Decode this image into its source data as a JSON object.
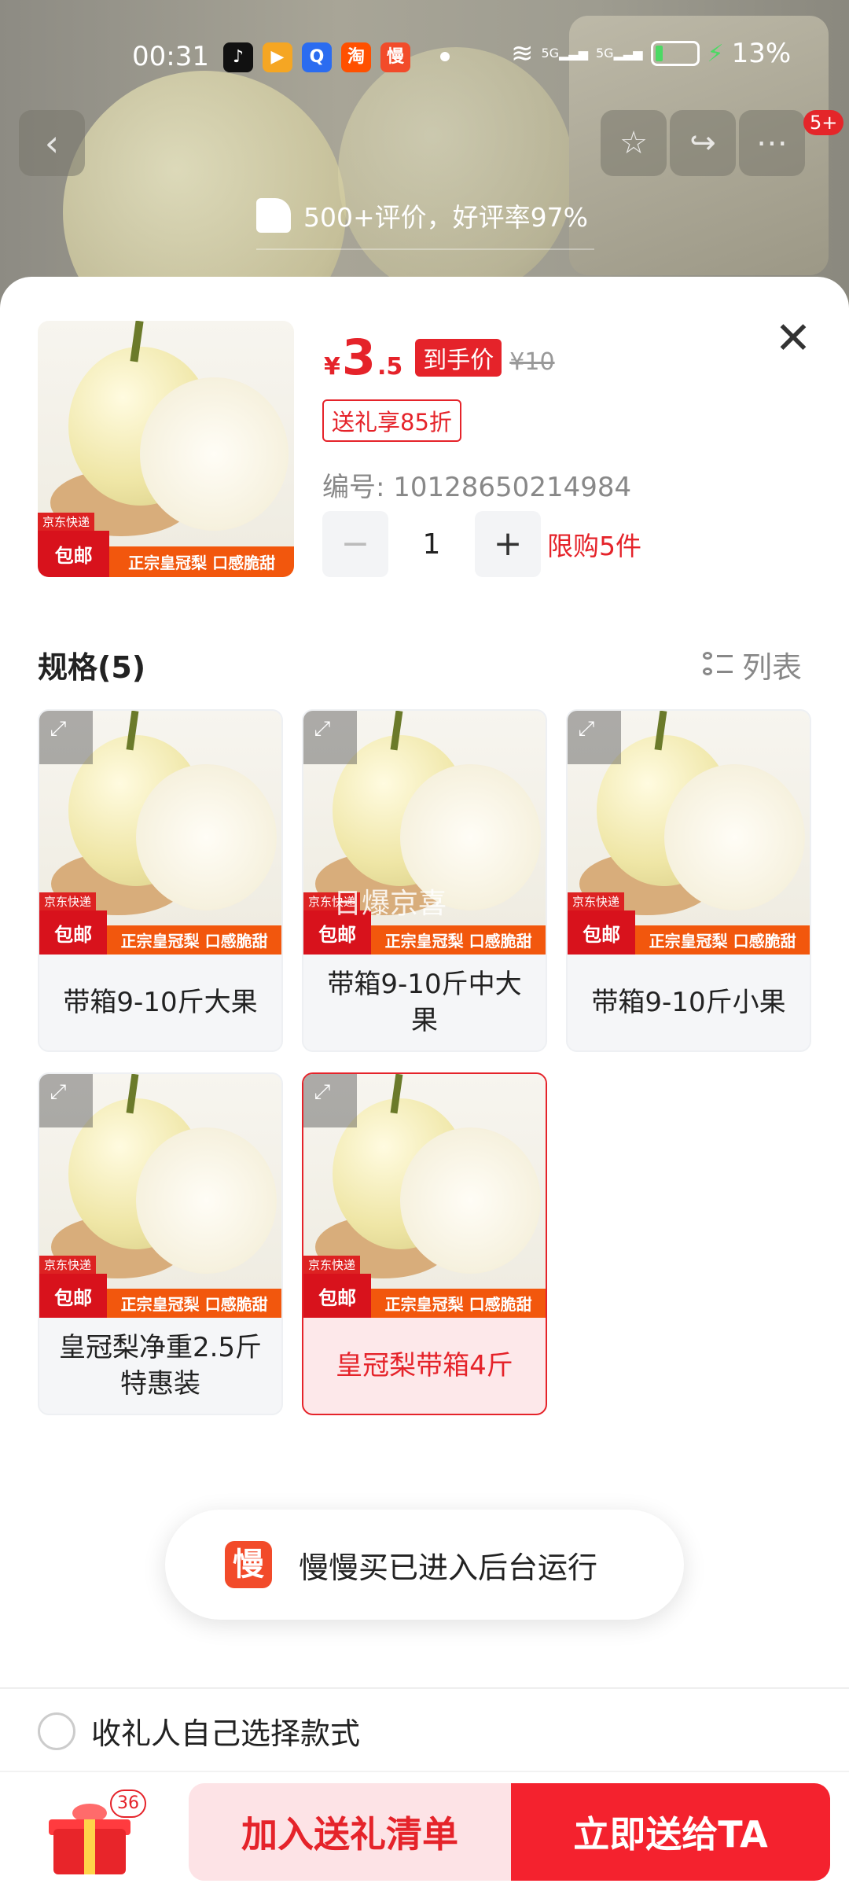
{
  "status_bar": {
    "time": "00:31",
    "battery": "13%",
    "apps": [
      {
        "name": "douyin",
        "glyph": "♪",
        "color": "#111"
      },
      {
        "name": "bilibili-live",
        "glyph": "▶",
        "color": "#f5a623"
      },
      {
        "name": "search",
        "glyph": "Q",
        "color": "#2b6cf0"
      },
      {
        "name": "taobao",
        "glyph": "淘",
        "color": "#ff5000"
      },
      {
        "name": "manmanmai",
        "glyph": "慢",
        "color": "#f24b2a"
      }
    ]
  },
  "background_page": {
    "rating": "500+评价，好评率97%",
    "cart_badge": "5+"
  },
  "product": {
    "yen": "¥",
    "price_int": "3",
    "price_dec": ".5",
    "price_label": "到手价",
    "original_price": "¥10",
    "gift_discount": "送礼享85折",
    "sku_number": "编号: 10128650214984",
    "quantity": "1",
    "limit": "限购5件",
    "image_tags": {
      "top": "京东快递",
      "red": "包邮",
      "banner": "正宗皇冠梨 口感脆甜"
    }
  },
  "specs": {
    "title": "规格(5)",
    "view_toggle": "列表",
    "items": [
      {
        "label": "带箱9-10斤大果",
        "selected": false
      },
      {
        "label": "带箱9-10斤中大果",
        "selected": false
      },
      {
        "label": "带箱9-10斤小果",
        "selected": false
      },
      {
        "label": "皇冠梨净重2.5斤特惠装",
        "selected": false
      },
      {
        "label": "皇冠梨带箱4斤",
        "selected": true
      }
    ],
    "watermark": "日爆京喜"
  },
  "toast": {
    "icon": "慢",
    "text": "慢慢买已进入后台运行"
  },
  "recipient_option": "收礼人自己选择款式",
  "bottom_bar": {
    "gift_count": "36",
    "add_button": "加入送礼清单",
    "send_button": "立即送给TA"
  },
  "colors": {
    "accent": "#e5232a",
    "send": "#f4222e",
    "add_bg": "#fde3e6"
  }
}
